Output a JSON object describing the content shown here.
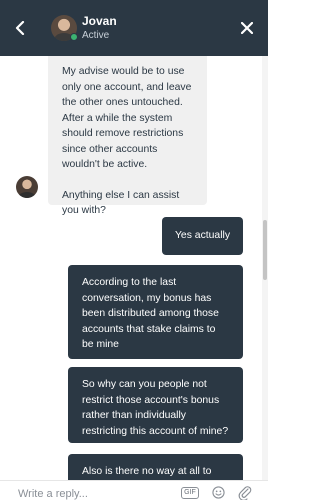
{
  "header": {
    "agent_name": "Jovan",
    "agent_status": "Active",
    "back_icon": "chevron-left-icon",
    "close_icon": "close-icon"
  },
  "messages": [
    {
      "direction": "in",
      "paragraphs": [
        "My advise would be to use only one account, and leave the other ones untouched. After a while the system should remove restrictions since other accounts wouldn't be active.",
        "Anything else I can assist you with?"
      ]
    },
    {
      "direction": "out",
      "text": "Yes actually"
    },
    {
      "direction": "out",
      "text": "According to the last conversation, my bonus has been distributed among those accounts that stake claims to be mine"
    },
    {
      "direction": "out",
      "text": "So why can you people not restrict those account's bonus rather than individually restricting this account of mine?"
    },
    {
      "direction": "out",
      "text": "Also is there no way at all to"
    }
  ],
  "composer": {
    "placeholder": "Write a reply...",
    "gif_label": "GIF",
    "emoji_icon": "emoji-icon",
    "attach_icon": "paperclip-icon"
  },
  "colors": {
    "header_bg": "#2b3844",
    "out_bubble": "#2b3844",
    "in_bubble": "#f0f0f0",
    "online": "#3cb371"
  }
}
